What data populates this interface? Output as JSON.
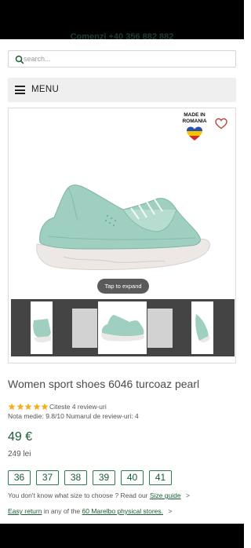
{
  "header": {
    "orders_text": "Comenzi +40 356 882 882"
  },
  "search": {
    "placeholder": "search..."
  },
  "menu": {
    "label": "MENU"
  },
  "badge": {
    "line1": "MADE IN",
    "line2": "ROMANIA"
  },
  "gallery": {
    "expand_label": "Tap to expand"
  },
  "product": {
    "title": "Women sport shoes 6046 turcoaz pearl",
    "rating_stars": 5,
    "reviews_link": "Citeste 4 review-uri",
    "rating_text": "Nota medie: 9.8/10 Numarul de review-uri: 4",
    "price": "49 €",
    "price_old": "249 lei"
  },
  "sizes": [
    "36",
    "37",
    "38",
    "39",
    "40",
    "41"
  ],
  "guide": {
    "text": "You don't know what size to choose ? Read our",
    "link": "Size guide",
    "chevron": ">"
  },
  "return": {
    "link": "Easy return",
    "middle": "in any of the",
    "link2": "60 Marelbo physical stores.",
    "chevron": ">"
  },
  "colors": {
    "accent": "#1a5c36",
    "shoe": "#9fcfc0",
    "sole": "#ece8e6"
  }
}
